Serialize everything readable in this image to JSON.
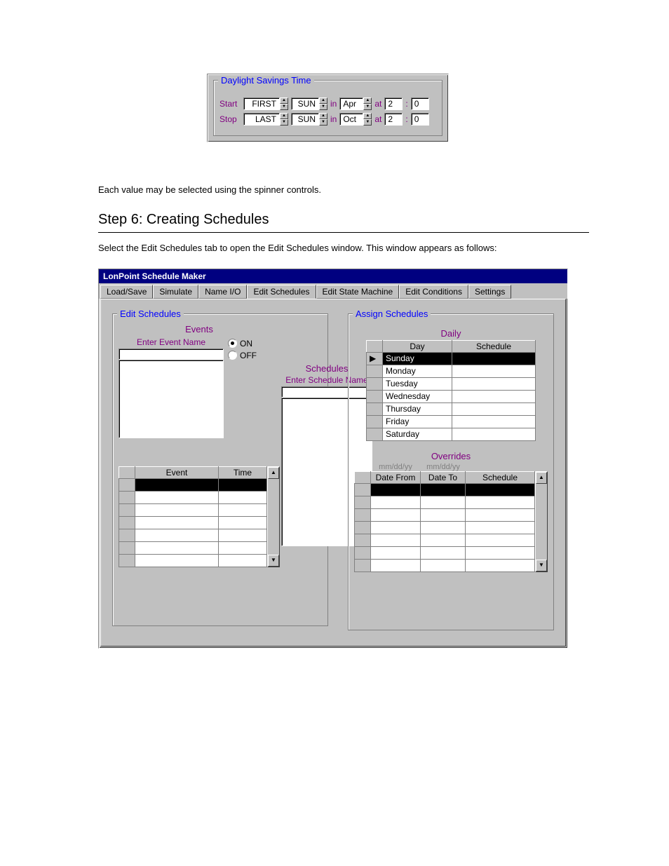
{
  "dst": {
    "title": "Daylight Savings Time",
    "start_label": "Start",
    "stop_label": "Stop",
    "in_label": "in",
    "at_label": "at",
    "colon": ":",
    "start": {
      "occurrence": "FIRST",
      "dow": "SUN",
      "month": "Apr",
      "hour": "2",
      "minute": "0"
    },
    "stop": {
      "occurrence": "LAST",
      "dow": "SUN",
      "month": "Oct",
      "hour": "2",
      "minute": "0"
    }
  },
  "body_text": {
    "p1": "Each value may be selected using the spinner controls.",
    "heading": "Step 6: Creating Schedules",
    "p2": "Select the Edit Schedules tab to open the Edit Schedules window. This window appears as follows:"
  },
  "window": {
    "title": "LonPoint Schedule Maker",
    "tabs": [
      "Load/Save",
      "Simulate",
      "Name I/O",
      "Edit Schedules",
      "Edit State Machine",
      "Edit Conditions",
      "Settings"
    ],
    "active_tab": "Edit Schedules",
    "edit_group_title": "Edit Schedules",
    "assign_group_title": "Assign Schedules",
    "events_title": "Events",
    "enter_event_label": "Enter Event Name",
    "radio_on": "ON",
    "radio_off": "OFF",
    "schedules_title": "Schedules",
    "enter_schedule_label": "Enter Schedule Name",
    "event_table_headers": [
      "Event",
      "Time"
    ],
    "daily_title": "Daily",
    "daily_headers": [
      "Day",
      "Schedule"
    ],
    "days": [
      "Sunday",
      "Monday",
      "Tuesday",
      "Wednesday",
      "Thursday",
      "Friday",
      "Saturday"
    ],
    "overrides_title": "Overrides",
    "mmdd_hint": "mm/dd/yy",
    "override_headers": [
      "Date From",
      "Date To",
      "Schedule"
    ]
  }
}
